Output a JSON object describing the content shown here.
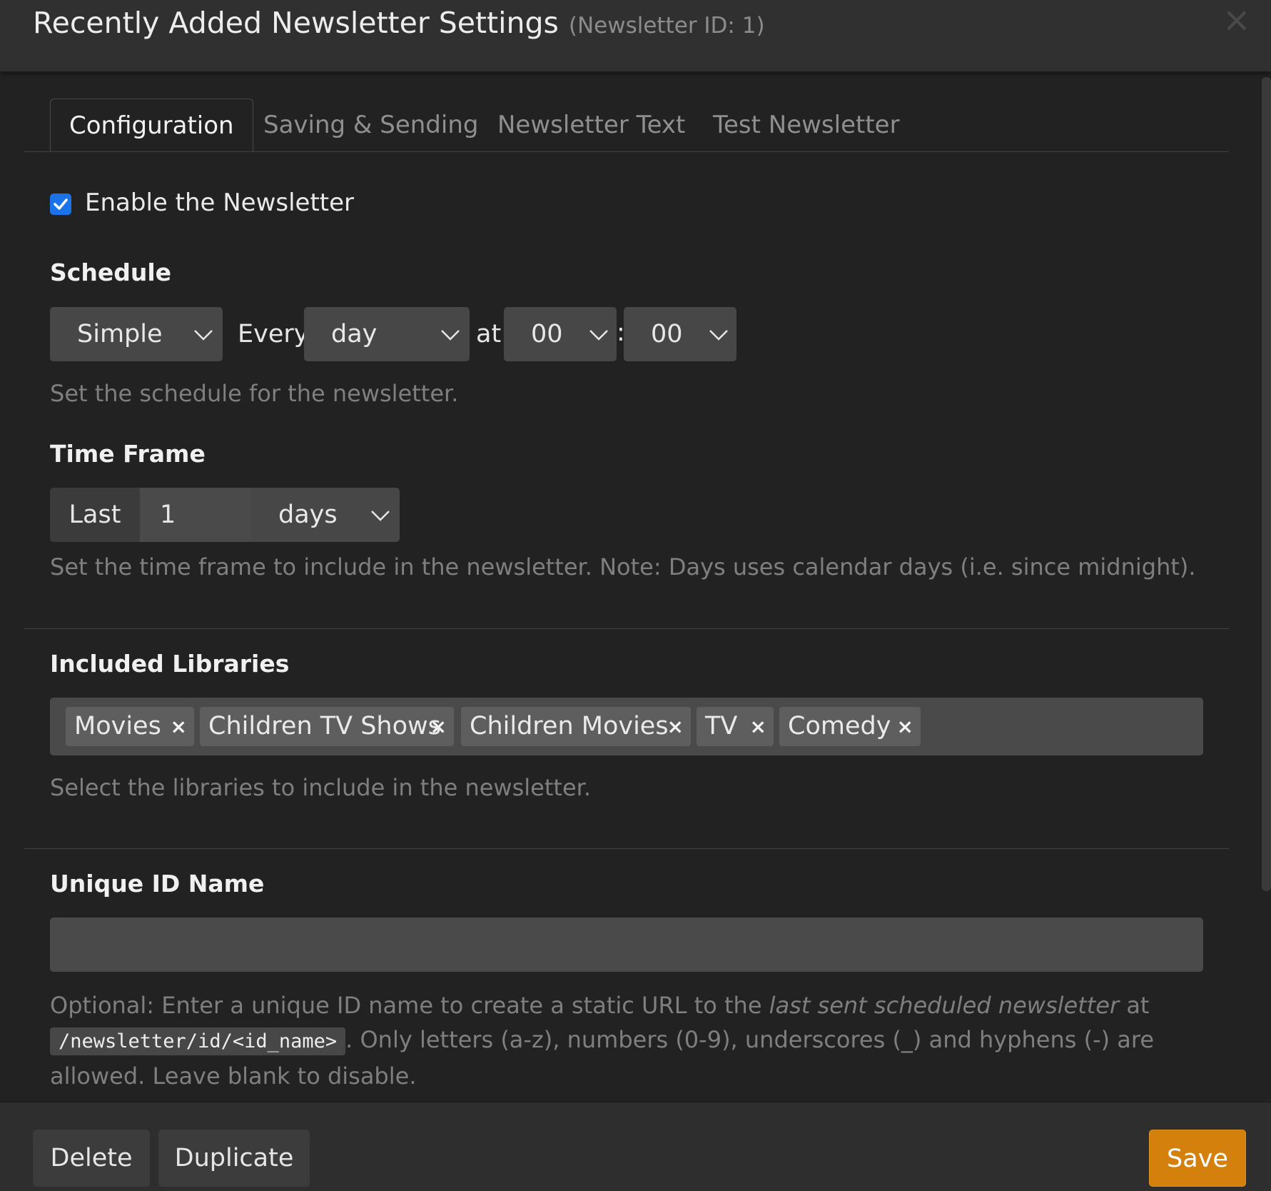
{
  "header": {
    "title": "Recently Added Newsletter Settings",
    "subtitle": "(Newsletter ID: 1)",
    "close_icon": "×"
  },
  "tabs": [
    {
      "label": "Configuration",
      "active": true
    },
    {
      "label": "Saving & Sending",
      "active": false
    },
    {
      "label": "Newsletter Text",
      "active": false
    },
    {
      "label": "Test Newsletter",
      "active": false
    }
  ],
  "enable": {
    "label": "Enable the Newsletter",
    "checked": true
  },
  "schedule": {
    "label": "Schedule",
    "type": "Simple",
    "every_label": "Every",
    "period": "day",
    "at_label": "at",
    "hour": "00",
    "colon": ":",
    "minute": "00",
    "help": "Set the schedule for the newsletter."
  },
  "timeframe": {
    "label": "Time Frame",
    "prefix": "Last",
    "value": "1",
    "unit": "days",
    "help": "Set the time frame to include in the newsletter. Note: Days uses calendar days (i.e. since midnight)."
  },
  "libraries": {
    "label": "Included Libraries",
    "items": [
      "Movies",
      "Children TV Shows",
      "Children Movies",
      "TV",
      "Comedy"
    ],
    "remove_symbol": "×",
    "help": "Select the libraries to include in the newsletter."
  },
  "unique_id": {
    "label": "Unique ID Name",
    "value": "",
    "help_part1": "Optional: Enter a unique ID name to create a static URL to the",
    "help_em": "last sent scheduled newsletter",
    "help_part2": "at",
    "help_code": "/newsletter/id/<id_name>",
    "help_part3": ". Only letters (a-z), numbers (0-9), underscores (_) and hyphens (-) are allowed. Leave blank to disable."
  },
  "footer": {
    "delete_label": "Delete",
    "duplicate_label": "Duplicate",
    "save_label": "Save"
  },
  "colors": {
    "accent": "#d4800d",
    "checkbox": "#1a73e8",
    "background": "#222222"
  }
}
